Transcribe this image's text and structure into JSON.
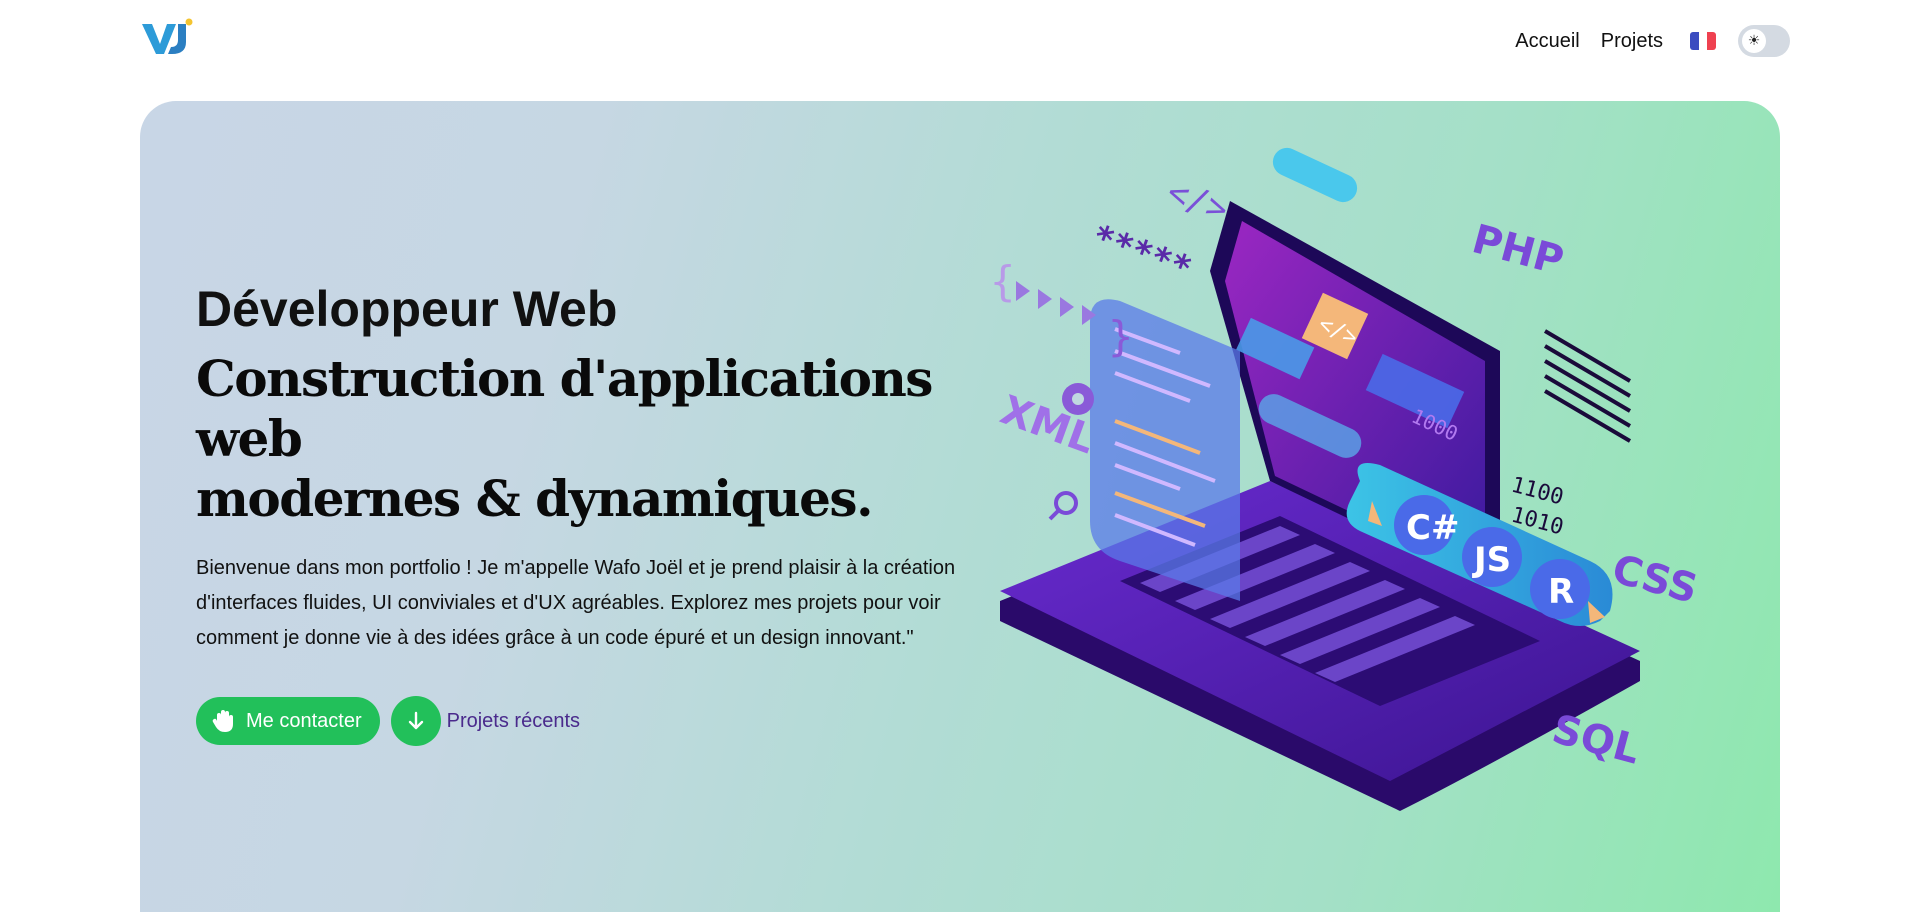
{
  "header": {
    "logo_text": "VJ",
    "nav": [
      {
        "label": "Accueil"
      },
      {
        "label": "Projets"
      }
    ],
    "language_flag": "fr-flag-icon",
    "theme_toggle_icon": "sun-icon"
  },
  "hero": {
    "role": "Développeur Web",
    "headline_line1": "Construction d'applications web",
    "headline_line2": "modernes & dynamiques.",
    "intro": "Bienvenue dans mon portfolio ! Je m'appelle Wafo Joël et je prend plaisir à la création d'interfaces fluides, UI conviviales et d'UX agréables. Explorez mes projets pour voir comment je donne vie à des idées grâce à un code épuré et un design innovant.\"",
    "contact_label": "Me contacter",
    "contact_icon": "waving-hand-icon",
    "scroll_icon": "arrow-down-icon",
    "recent_projects_label": "Projets récents"
  },
  "illustration": {
    "tags": {
      "php": "PHP",
      "xml": "XML",
      "css": "CSS",
      "sql": "SQL",
      "csharp": "C#",
      "js": "JS",
      "r": "R",
      "code": "</>",
      "stars": "*****",
      "binary_1": "1000",
      "binary_2": "1100",
      "binary_3": "1010"
    }
  },
  "colors": {
    "accent_green": "#22c05a",
    "link_purple": "#4a2a8c",
    "hero_gradient_start": "#c8d6e6",
    "hero_gradient_end": "#8ee8ae"
  }
}
